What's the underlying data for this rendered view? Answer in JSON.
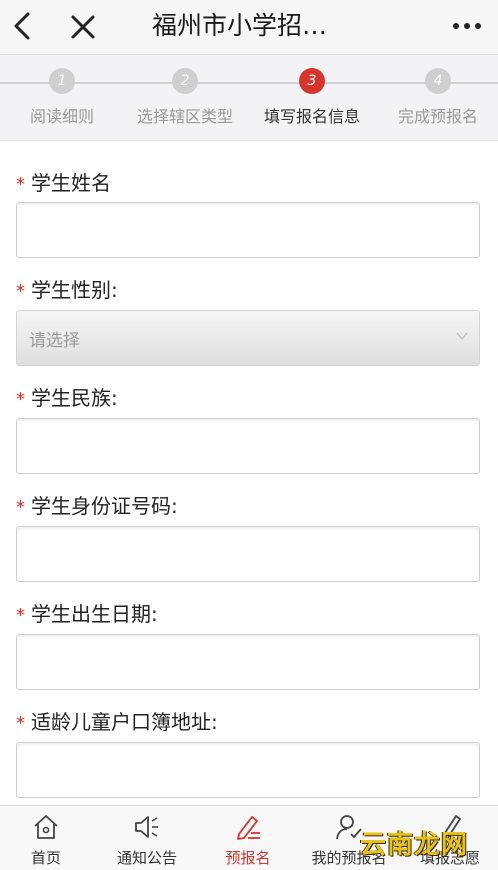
{
  "header": {
    "title": "福州市小学招…",
    "back_icon": "back-arrow-icon",
    "close_icon": "close-icon",
    "more_icon": "more-dots-icon"
  },
  "steps": [
    {
      "num": "1",
      "label": "阅读细则",
      "active": false
    },
    {
      "num": "2",
      "label": "选择辖区类型",
      "active": false
    },
    {
      "num": "3",
      "label": "填写报名信息",
      "active": true
    },
    {
      "num": "4",
      "label": "完成预报名",
      "active": false
    }
  ],
  "form": {
    "required_mark": "*",
    "name": {
      "label": "学生姓名",
      "value": ""
    },
    "gender": {
      "label": "学生性别:",
      "value": "请选择"
    },
    "ethnicity": {
      "label": "学生民族:",
      "value": ""
    },
    "id_number": {
      "label": "学生身份证号码:",
      "value": ""
    },
    "birthdate": {
      "label": "学生出生日期:",
      "value": ""
    },
    "address": {
      "label": "适龄儿童户口簿地址:",
      "value": ""
    }
  },
  "tabbar": [
    {
      "label": "首页",
      "icon": "home-icon",
      "active": false
    },
    {
      "label": "通知公告",
      "icon": "megaphone-icon",
      "active": false
    },
    {
      "label": "预报名",
      "icon": "edit-icon",
      "active": true
    },
    {
      "label": "我的预报名",
      "icon": "user-check-icon",
      "active": false
    },
    {
      "label": "填报志愿",
      "icon": "pen-icon",
      "active": false
    }
  ],
  "watermark": "云南龙网",
  "colors": {
    "accent": "#d9342b",
    "step_inactive": "#cfcfcf",
    "watermark": "#e8c21a"
  }
}
